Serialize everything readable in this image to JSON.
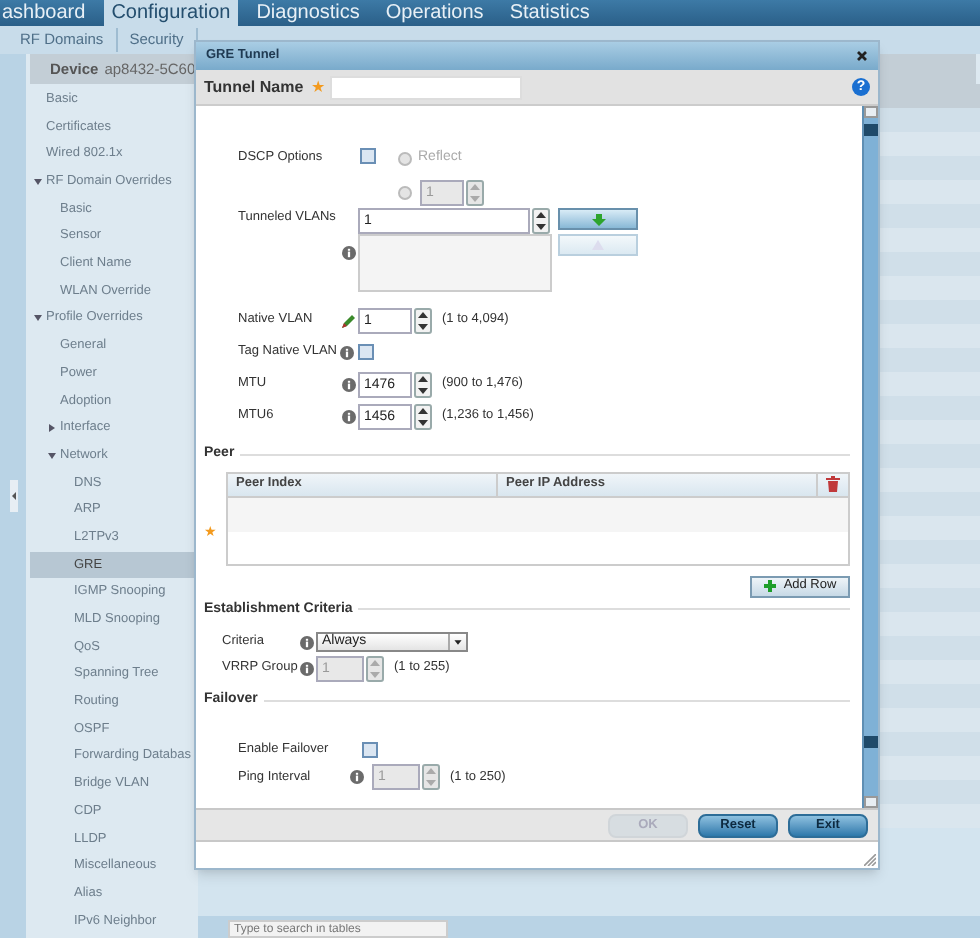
{
  "top_nav": {
    "tabs": [
      {
        "label": "ashboard",
        "selected": false
      },
      {
        "label": "Configuration",
        "selected": true
      },
      {
        "label": "Diagnostics",
        "selected": false
      },
      {
        "label": "Operations",
        "selected": false
      },
      {
        "label": "Statistics",
        "selected": false
      }
    ]
  },
  "sub_nav": {
    "items": [
      "RF Domains",
      "Security"
    ]
  },
  "device": {
    "label": "Device",
    "name": "ap8432-5C60"
  },
  "sidebar": {
    "items": [
      {
        "label": "Basic",
        "selected": false
      },
      {
        "label": "Certificates",
        "selected": false
      },
      {
        "label": "Wired 802.1x",
        "selected": false
      },
      {
        "label": "RF Domain Overrides",
        "selected": false,
        "expanded": true,
        "children": [
          {
            "label": "Basic",
            "selected": false
          },
          {
            "label": "Sensor",
            "selected": false
          },
          {
            "label": "Client Name",
            "selected": false
          },
          {
            "label": "WLAN Override",
            "selected": false
          }
        ]
      },
      {
        "label": "Profile Overrides",
        "selected": false,
        "expanded": true,
        "children": [
          {
            "label": "General",
            "selected": false
          },
          {
            "label": "Power",
            "selected": false
          },
          {
            "label": "Adoption",
            "selected": false
          },
          {
            "label": "Interface",
            "selected": false,
            "expanded": false
          },
          {
            "label": "Network",
            "selected": false,
            "expanded": true,
            "children": [
              {
                "label": "DNS",
                "selected": false
              },
              {
                "label": "ARP",
                "selected": false
              },
              {
                "label": "L2TPv3",
                "selected": false
              },
              {
                "label": "GRE",
                "selected": true
              },
              {
                "label": "IGMP Snooping",
                "selected": false
              },
              {
                "label": "MLD Snooping",
                "selected": false
              },
              {
                "label": "QoS",
                "selected": false
              },
              {
                "label": "Spanning Tree",
                "selected": false
              },
              {
                "label": "Routing",
                "selected": false
              },
              {
                "label": "OSPF",
                "selected": false
              },
              {
                "label": "Forwarding Databas",
                "selected": false
              },
              {
                "label": "Bridge VLAN",
                "selected": false
              },
              {
                "label": "CDP",
                "selected": false
              },
              {
                "label": "LLDP",
                "selected": false
              },
              {
                "label": "Miscellaneous",
                "selected": false
              },
              {
                "label": "Alias",
                "selected": false
              },
              {
                "label": "IPv6 Neighbor",
                "selected": false
              }
            ]
          }
        ]
      }
    ]
  },
  "search_field": {
    "placeholder": "Type to search in tables"
  },
  "dialog": {
    "title": "GRE Tunnel",
    "tunnel_name": {
      "label": "Tunnel Name",
      "required_mark": "★"
    },
    "help": "?",
    "dscp": {
      "label": "DSCP Options",
      "checked": false,
      "options": [
        {
          "kind": "text",
          "label": "Reflect",
          "selected": false
        },
        {
          "kind": "spinner",
          "value": "1",
          "selected": false
        }
      ]
    },
    "tunneled_vlans": {
      "label": "Tunneled VLANs",
      "value": "1"
    },
    "native_vlan": {
      "label": "Native VLAN",
      "value": "1",
      "range": "(1 to 4,094)"
    },
    "tag_native_vlan": {
      "label": "Tag Native VLAN",
      "checked": false
    },
    "mtu": {
      "label": "MTU",
      "value": "1476",
      "range": "(900 to 1,476)"
    },
    "mtu6": {
      "label": "MTU6",
      "value": "1456",
      "range": "(1,236 to 1,456)"
    },
    "peer": {
      "title": "Peer",
      "required_mark": "★",
      "columns": [
        "Peer Index",
        "Peer IP Address"
      ],
      "add_button": "Add Row"
    },
    "establishment": {
      "title": "Establishment Criteria",
      "criteria": {
        "label": "Criteria",
        "value": "Always"
      },
      "vrrp_group": {
        "label": "VRRP Group",
        "value": "1",
        "range": "(1 to 255)",
        "disabled": true
      }
    },
    "failover": {
      "title": "Failover",
      "enable": {
        "label": "Enable Failover",
        "checked": false
      },
      "ping_interval": {
        "label": "Ping Interval",
        "value": "1",
        "range": "(1 to 250)",
        "disabled": true
      }
    },
    "buttons": [
      {
        "label": "OK",
        "disabled": true
      },
      {
        "label": "Reset",
        "disabled": false
      },
      {
        "label": "Exit",
        "disabled": false
      }
    ]
  }
}
